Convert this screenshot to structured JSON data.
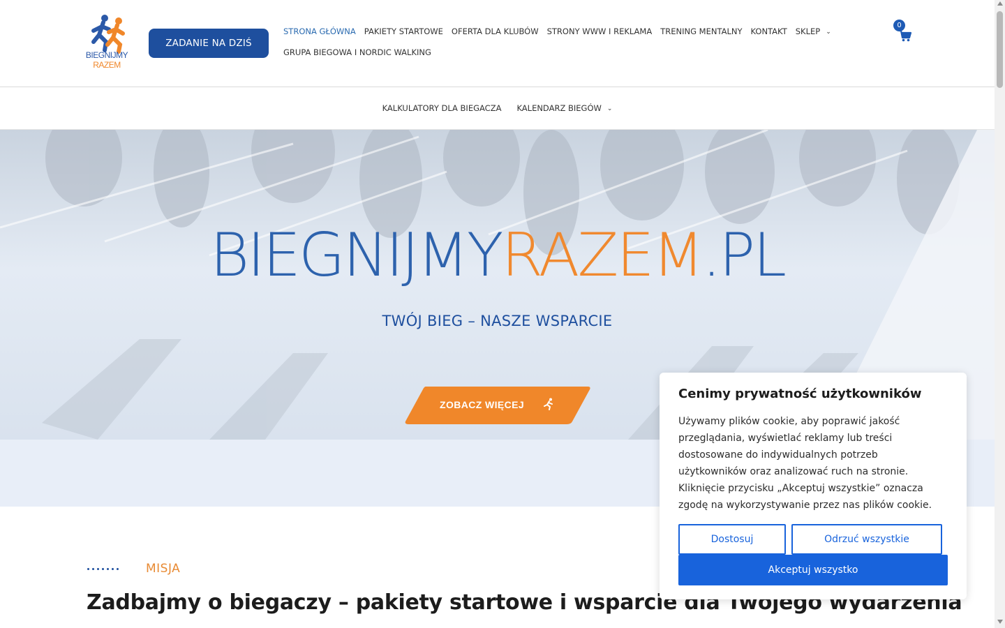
{
  "header": {
    "logo_line1": "BIEGNIJMY",
    "logo_line2": "RAZEM",
    "cta_label": "ZADANIE NA DZIŚ",
    "nav_row1": [
      {
        "label": "STRONA GŁÓWNA",
        "active": true
      },
      {
        "label": "PAKIETY STARTOWE"
      },
      {
        "label": "OFERTA DLA KLUBÓW"
      },
      {
        "label": "STRONY WWW I REKLAMA"
      },
      {
        "label": "TRENING MENTALNY"
      },
      {
        "label": "KONTAKT"
      },
      {
        "label": "SKLEP",
        "dropdown": true
      }
    ],
    "nav_row2": [
      {
        "label": "GRUPA BIEGOWA I NORDIC WALKING"
      }
    ],
    "cart_count": "0",
    "cart_icon": "cart-icon"
  },
  "subnav": [
    {
      "label": "KALKULATORY DLA BIEGACZA"
    },
    {
      "label": "KALENDARZ BIEGÓW",
      "dropdown": true
    }
  ],
  "hero": {
    "title_part1": "BIEGNIJMY",
    "title_part2": "RAZEM",
    "title_part3": ".PL",
    "subtitle": "TWÓJ BIEG – NASZE WSPARCIE",
    "button_label": "ZOBACZ WIĘCEJ",
    "button_icon": "runner-icon"
  },
  "mission": {
    "eyebrow": "MISJA",
    "headline": "Zadbajmy o biegaczy – pakiety startowe i wsparcie dla Twojego wydarzenia"
  },
  "cookie": {
    "title": "Cenimy prywatność użytkowników",
    "body": "Używamy plików cookie, aby poprawić jakość przeglądania, wyświetlać reklamy lub treści dostosowane do indywidualnych potrzeb użytkowników oraz analizować ruch na stronie. Kliknięcie przycisku „Akceptuj wszystkie” oznacza zgodę na wykorzystywanie przez nas plików cookie.",
    "customize_label": "Dostosuj",
    "reject_label": "Odrzuć wszystkie",
    "accept_label": "Akceptuj wszystko"
  },
  "colors": {
    "brand_blue": "#1e4f9e",
    "brand_orange": "#f0892f",
    "cookie_blue": "#1863dc"
  }
}
